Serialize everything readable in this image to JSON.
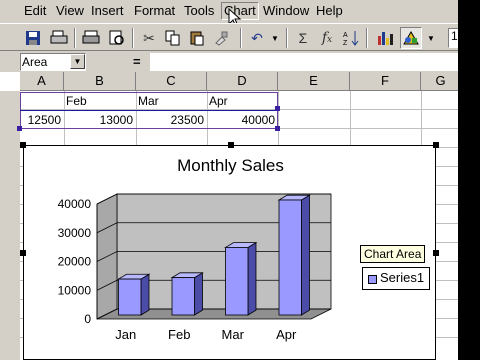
{
  "menu": {
    "items": [
      "Edit",
      "View",
      "Insert",
      "Format",
      "Tools",
      "Chart",
      "Window",
      "Help"
    ],
    "active": "Chart"
  },
  "toolbar": {
    "buttons": [
      "save",
      "print-preview",
      "print",
      "print-preview-2",
      "cut",
      "copy",
      "paste",
      "format-painter",
      "undo",
      "autosum",
      "paste-function",
      "sort",
      "chart-wizard",
      "chart-tools"
    ],
    "zoom_label": "1"
  },
  "formula_bar": {
    "name_box": "Area",
    "equals": "="
  },
  "sheet": {
    "columns": [
      "A",
      "B",
      "C",
      "D",
      "E",
      "F",
      "G"
    ],
    "header_row": [
      "",
      "Feb",
      "Mar",
      "Apr"
    ],
    "value_row": [
      "12500",
      "13000",
      "23500",
      "40000"
    ]
  },
  "chart_tooltip": "Chart Area",
  "chart_data": {
    "type": "bar",
    "title": "Monthly Sales",
    "categories": [
      "Jan",
      "Feb",
      "Mar",
      "Apr"
    ],
    "series": [
      {
        "name": "Series1",
        "values": [
          12500,
          13000,
          23500,
          40000
        ],
        "color": "#9999ff"
      }
    ],
    "ylim": [
      0,
      40000
    ],
    "yticks": [
      "0",
      "10000",
      "20000",
      "30000",
      "40000"
    ],
    "grid": true,
    "legend": "right",
    "style": "3d-column"
  }
}
